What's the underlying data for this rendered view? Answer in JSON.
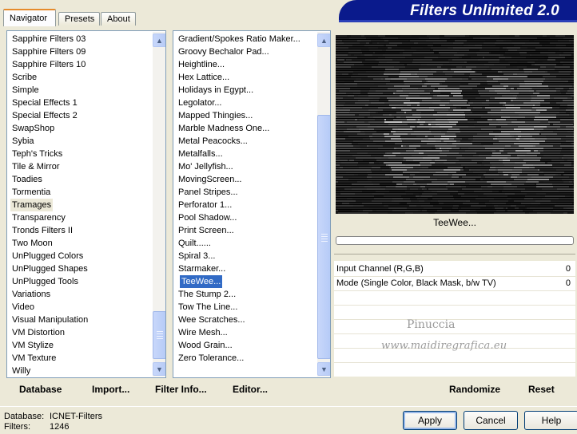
{
  "app": {
    "banner_title": "Filters Unlimited 2.0"
  },
  "tabs": [
    "Navigator",
    "Presets",
    "About"
  ],
  "categories": {
    "items": [
      "Sapphire Filters 03",
      "Sapphire Filters 09",
      "Sapphire Filters 10",
      "Scribe",
      "Simple",
      "Special Effects 1",
      "Special Effects 2",
      "SwapShop",
      "Sybia",
      "Teph's Tricks",
      "Tile & Mirror",
      "Toadies",
      "Tormentia",
      "Tramages",
      "Transparency",
      "Tronds Filters II",
      "Two Moon",
      "UnPlugged Colors",
      "UnPlugged Shapes",
      "UnPlugged Tools",
      "Variations",
      "Video",
      "Visual Manipulation",
      "VM Distortion",
      "VM Stylize",
      "VM Texture",
      "Willy"
    ],
    "selected": "Tramages"
  },
  "filters": {
    "items": [
      "Gradient/Spokes Ratio Maker...",
      "Groovy Bechalor Pad...",
      "Heightline...",
      "Hex Lattice...",
      "Holidays in Egypt...",
      "Legolator...",
      "Mapped Thingies...",
      "Marble Madness One...",
      "Metal Peacocks...",
      "Metalfalls...",
      "Mo' Jellyfish...",
      "MovingScreen...",
      "Panel Stripes...",
      "Perforator 1...",
      "Pool Shadow...",
      "Print Screen...",
      "Quilt......",
      "Spiral 3...",
      "Starmaker...",
      "TeeWee...",
      "The Stump 2...",
      "Tow The Line...",
      "Wee Scratches...",
      "Wire Mesh...",
      "Wood Grain...",
      "Zero Tolerance..."
    ],
    "selected": "TeeWee..."
  },
  "left_commands": [
    "Database",
    "Import...",
    "Filter Info...",
    "Editor..."
  ],
  "selected_filter_label": "TeeWee...",
  "parameters": [
    {
      "label": "Input Channel (R,G,B)",
      "value": "0"
    },
    {
      "label": "Mode (Single Color, Black Mask, b/w TV)",
      "value": "0"
    }
  ],
  "watermark": {
    "line1": "Pinuccia",
    "line2": "www.maidiregrafica.eu"
  },
  "right_commands": [
    "Randomize",
    "Reset"
  ],
  "footer": {
    "database_label": "Database:",
    "database_value": "ICNET-Filters",
    "filters_label": "Filters:",
    "filters_value": "1246"
  },
  "buttons": {
    "apply": "Apply",
    "cancel": "Cancel",
    "help": "Help"
  },
  "colors": {
    "banner": "#0a1a8c",
    "selection": "#316ac5",
    "tab_accent": "#e68b2c"
  }
}
